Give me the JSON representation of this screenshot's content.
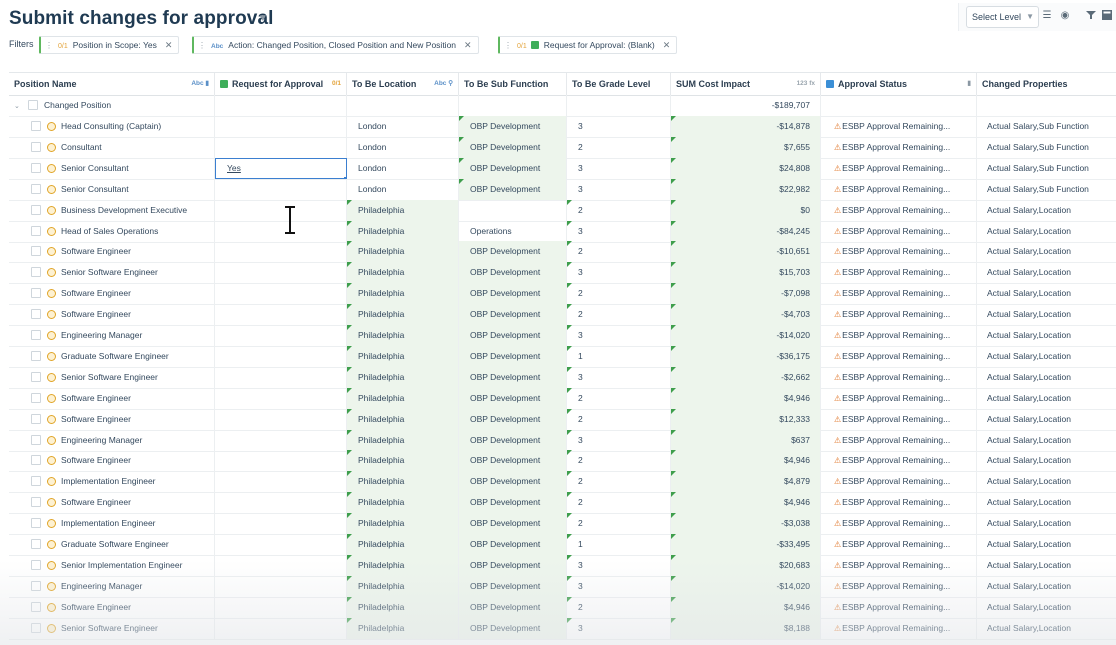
{
  "page": {
    "title": "Submit changes for approval",
    "title_caret_icon": "chevron-down-icon"
  },
  "toolbar": {
    "select_level": "Select Level",
    "icons": [
      "list-icon",
      "globe-icon",
      "filter-icon",
      "grid-icon"
    ]
  },
  "filters": {
    "label": "Filters",
    "chips": [
      {
        "count": "0/1",
        "type": "",
        "text": "Position in Scope: Yes"
      },
      {
        "count": "",
        "type": "Abc",
        "text": "Action: Changed Position, Closed Position and New Position"
      },
      {
        "count": "0/1",
        "type": "",
        "text": "Request for Approval: (Blank)"
      }
    ]
  },
  "columns": {
    "position_name": {
      "label": "Position Name",
      "type": "Abc"
    },
    "request_for_approval": {
      "label": "Request for Approval",
      "count": "0/1"
    },
    "to_be_location": {
      "label": "To Be Location",
      "type": "Abc"
    },
    "to_be_sub_function": {
      "label": "To Be Sub Function"
    },
    "to_be_grade_level": {
      "label": "To Be Grade Level"
    },
    "sum_cost_impact": {
      "label": "SUM Cost Impact",
      "type": "123 fx"
    },
    "approval_status": {
      "label": "Approval Status"
    },
    "changed_properties": {
      "label": "Changed Properties"
    }
  },
  "group": {
    "label": "Changed Position",
    "total": "-$189,707"
  },
  "colors": {
    "accent_green": "#3e9e4c",
    "green_cell_bg": "#edf5ec",
    "warning": "#e0762a",
    "active_border": "#3b7fd0"
  },
  "rows": [
    {
      "name": "Head Consulting (Captain)",
      "approval": "",
      "location": "London",
      "sub_function": "OBP Development",
      "grade": "3",
      "cost": "-$14,878",
      "status": "ESBP Approval Remaining...",
      "changed": "Actual Salary,Sub Function"
    },
    {
      "name": "Consultant",
      "approval": "",
      "location": "London",
      "sub_function": "OBP Development",
      "grade": "2",
      "cost": "$7,655",
      "status": "ESBP Approval Remaining...",
      "changed": "Actual Salary,Sub Function"
    },
    {
      "name": "Senior Consultant",
      "approval": "Yes",
      "location": "London",
      "sub_function": "OBP Development",
      "grade": "3",
      "cost": "$24,808",
      "status": "ESBP Approval Remaining...",
      "changed": "Actual Salary,Sub Function"
    },
    {
      "name": "Senior Consultant",
      "approval": "",
      "location": "London",
      "sub_function": "OBP Development",
      "grade": "3",
      "cost": "$22,982",
      "status": "ESBP Approval Remaining...",
      "changed": "Actual Salary,Sub Function"
    },
    {
      "name": "Business Development Executive",
      "approval": "",
      "location": "Philadelphia",
      "sub_function": "",
      "grade": "2",
      "cost": "$0",
      "status": "ESBP Approval Remaining...",
      "changed": "Actual Salary,Location"
    },
    {
      "name": "Head of Sales Operations",
      "approval": "",
      "location": "Philadelphia",
      "sub_function": "Operations",
      "grade": "3",
      "cost": "-$84,245",
      "status": "ESBP Approval Remaining...",
      "changed": "Actual Salary,Location"
    },
    {
      "name": "Software Engineer",
      "approval": "",
      "location": "Philadelphia",
      "sub_function": "OBP Development",
      "grade": "2",
      "cost": "-$10,651",
      "status": "ESBP Approval Remaining...",
      "changed": "Actual Salary,Location"
    },
    {
      "name": "Senior Software Engineer",
      "approval": "",
      "location": "Philadelphia",
      "sub_function": "OBP Development",
      "grade": "3",
      "cost": "$15,703",
      "status": "ESBP Approval Remaining...",
      "changed": "Actual Salary,Location"
    },
    {
      "name": "Software Engineer",
      "approval": "",
      "location": "Philadelphia",
      "sub_function": "OBP Development",
      "grade": "2",
      "cost": "-$7,098",
      "status": "ESBP Approval Remaining...",
      "changed": "Actual Salary,Location"
    },
    {
      "name": "Software Engineer",
      "approval": "",
      "location": "Philadelphia",
      "sub_function": "OBP Development",
      "grade": "2",
      "cost": "-$4,703",
      "status": "ESBP Approval Remaining...",
      "changed": "Actual Salary,Location"
    },
    {
      "name": "Engineering Manager",
      "approval": "",
      "location": "Philadelphia",
      "sub_function": "OBP Development",
      "grade": "3",
      "cost": "-$14,020",
      "status": "ESBP Approval Remaining...",
      "changed": "Actual Salary,Location"
    },
    {
      "name": "Graduate Software Engineer",
      "approval": "",
      "location": "Philadelphia",
      "sub_function": "OBP Development",
      "grade": "1",
      "cost": "-$36,175",
      "status": "ESBP Approval Remaining...",
      "changed": "Actual Salary,Location"
    },
    {
      "name": "Senior Software Engineer",
      "approval": "",
      "location": "Philadelphia",
      "sub_function": "OBP Development",
      "grade": "3",
      "cost": "-$2,662",
      "status": "ESBP Approval Remaining...",
      "changed": "Actual Salary,Location"
    },
    {
      "name": "Software Engineer",
      "approval": "",
      "location": "Philadelphia",
      "sub_function": "OBP Development",
      "grade": "2",
      "cost": "$4,946",
      "status": "ESBP Approval Remaining...",
      "changed": "Actual Salary,Location"
    },
    {
      "name": "Software Engineer",
      "approval": "",
      "location": "Philadelphia",
      "sub_function": "OBP Development",
      "grade": "2",
      "cost": "$12,333",
      "status": "ESBP Approval Remaining...",
      "changed": "Actual Salary,Location"
    },
    {
      "name": "Engineering Manager",
      "approval": "",
      "location": "Philadelphia",
      "sub_function": "OBP Development",
      "grade": "3",
      "cost": "$637",
      "status": "ESBP Approval Remaining...",
      "changed": "Actual Salary,Location"
    },
    {
      "name": "Software Engineer",
      "approval": "",
      "location": "Philadelphia",
      "sub_function": "OBP Development",
      "grade": "2",
      "cost": "$4,946",
      "status": "ESBP Approval Remaining...",
      "changed": "Actual Salary,Location"
    },
    {
      "name": "Implementation Engineer",
      "approval": "",
      "location": "Philadelphia",
      "sub_function": "OBP Development",
      "grade": "2",
      "cost": "$4,879",
      "status": "ESBP Approval Remaining...",
      "changed": "Actual Salary,Location"
    },
    {
      "name": "Software Engineer",
      "approval": "",
      "location": "Philadelphia",
      "sub_function": "OBP Development",
      "grade": "2",
      "cost": "$4,946",
      "status": "ESBP Approval Remaining...",
      "changed": "Actual Salary,Location"
    },
    {
      "name": "Implementation Engineer",
      "approval": "",
      "location": "Philadelphia",
      "sub_function": "OBP Development",
      "grade": "2",
      "cost": "-$3,038",
      "status": "ESBP Approval Remaining...",
      "changed": "Actual Salary,Location"
    },
    {
      "name": "Graduate Software Engineer",
      "approval": "",
      "location": "Philadelphia",
      "sub_function": "OBP Development",
      "grade": "1",
      "cost": "-$33,495",
      "status": "ESBP Approval Remaining...",
      "changed": "Actual Salary,Location"
    },
    {
      "name": "Senior Implementation Engineer",
      "approval": "",
      "location": "Philadelphia",
      "sub_function": "OBP Development",
      "grade": "3",
      "cost": "$20,683",
      "status": "ESBP Approval Remaining...",
      "changed": "Actual Salary,Location"
    },
    {
      "name": "Engineering Manager",
      "approval": "",
      "location": "Philadelphia",
      "sub_function": "OBP Development",
      "grade": "3",
      "cost": "-$14,020",
      "status": "ESBP Approval Remaining...",
      "changed": "Actual Salary,Location"
    },
    {
      "name": "Software Engineer",
      "approval": "",
      "location": "Philadelphia",
      "sub_function": "OBP Development",
      "grade": "2",
      "cost": "$4,946",
      "status": "ESBP Approval Remaining...",
      "changed": "Actual Salary,Location"
    },
    {
      "name": "Senior Software Engineer",
      "approval": "",
      "location": "Philadelphia",
      "sub_function": "OBP Development",
      "grade": "3",
      "cost": "$8,188",
      "status": "ESBP Approval Remaining...",
      "changed": "Actual Salary,Location"
    }
  ]
}
